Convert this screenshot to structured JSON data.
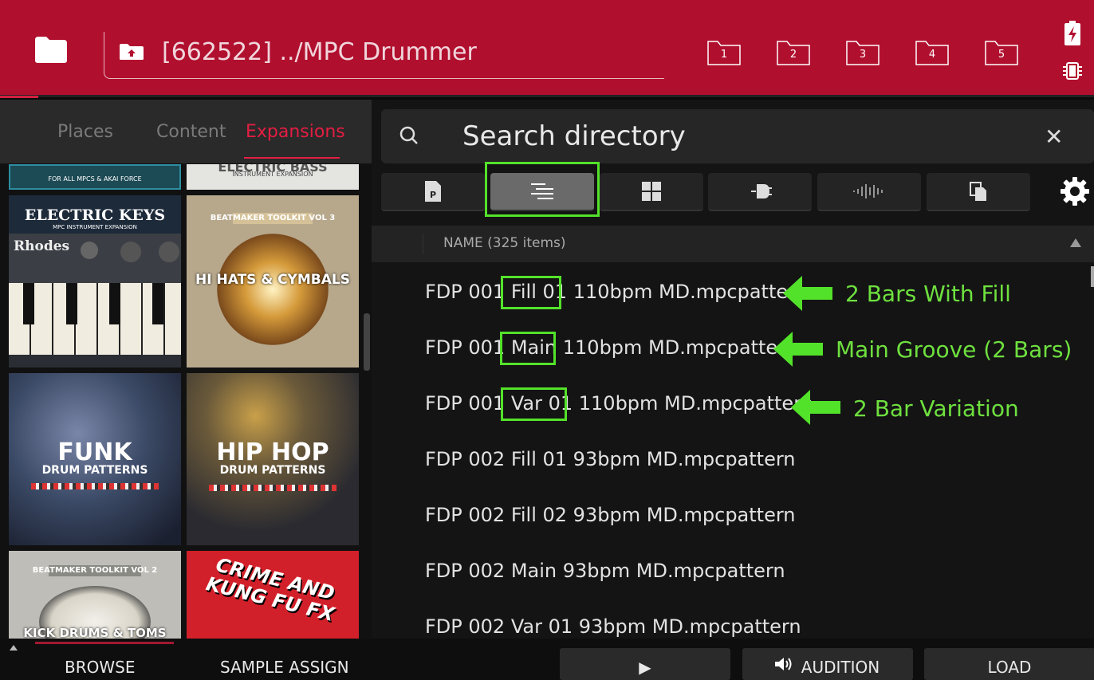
{
  "header": {
    "path": "[662522] ../MPC Drummer",
    "slots": [
      "1",
      "2",
      "3",
      "4",
      "5"
    ]
  },
  "tabs": [
    {
      "label": "Places",
      "active": false
    },
    {
      "label": "Content",
      "active": false
    },
    {
      "label": "Expansions",
      "active": true
    }
  ],
  "expansions": [
    {
      "title": "",
      "subtitle": "FOR ALL MPCS & AKAI FORCE",
      "bg": "#1c4a55"
    },
    {
      "title": "ELECTRIC BASS",
      "subtitle": "INSTRUMENT EXPANSION",
      "bg": "#e4e4e0"
    },
    {
      "title": "ELECTRIC KEYS",
      "subtitle": "MPC INSTRUMENT EXPANSION",
      "brand": "Rhodes",
      "bg": "#3b3f45"
    },
    {
      "title": "HI HATS & CYMBALS",
      "subtitle": "BEATMAKER TOOLKIT VOL 3",
      "bg": "#b7a88c"
    },
    {
      "title": "FUNK",
      "subtitle": "DRUM PATTERNS",
      "bg": "#3b4a66"
    },
    {
      "title": "HIP HOP",
      "subtitle": "DRUM PATTERNS",
      "bg": "#4a4a55"
    },
    {
      "title": "KICK DRUMS & TOMS",
      "subtitle": "BEATMAKER TOOLKIT VOL 2",
      "bg": "#bfbdb8"
    },
    {
      "title": "CRIME AND KUNG FU FX",
      "subtitle": "",
      "bg": "#d2202a"
    }
  ],
  "search": {
    "placeholder": "Search directory"
  },
  "filter_buttons": [
    {
      "name": "program",
      "active": false
    },
    {
      "name": "pattern",
      "active": true
    },
    {
      "name": "grid",
      "active": false
    },
    {
      "name": "plugin",
      "active": false
    },
    {
      "name": "audio",
      "active": false
    },
    {
      "name": "copy",
      "active": false
    }
  ],
  "list": {
    "header": "NAME (325 items)",
    "rows": [
      {
        "pre": "FDP 001 ",
        "hl": "Fill 01",
        "post": " 110bpm MD.mpcpattern"
      },
      {
        "pre": "FDP 001 ",
        "hl": "Main",
        "post": " 110bpm MD.mpcpattern"
      },
      {
        "pre": "FDP 001 ",
        "hl": "Var 01",
        "post": " 110bpm MD.mpcpattern"
      },
      {
        "pre": "FDP 002 Fill 01 93bpm MD.mpcpattern",
        "hl": "",
        "post": ""
      },
      {
        "pre": "FDP 002 Fill 02 93bpm MD.mpcpattern",
        "hl": "",
        "post": ""
      },
      {
        "pre": "FDP 002 Main 93bpm MD.mpcpattern",
        "hl": "",
        "post": ""
      },
      {
        "pre": "FDP 002 Var 01 93bpm MD.mpcpattern",
        "hl": "",
        "post": ""
      }
    ]
  },
  "annotations": [
    "2 Bars With Fill",
    "Main Groove (2 Bars)",
    "2 Bar Variation"
  ],
  "bottom": {
    "browse": "BROWSE",
    "sample_assign": "SAMPLE ASSIGN",
    "play": "▶",
    "audition": "AUDITION",
    "load": "LOAD"
  },
  "colors": {
    "header_red": "#b10f2e",
    "accent_red": "#e41d42",
    "annotation_green": "#53e22a"
  }
}
